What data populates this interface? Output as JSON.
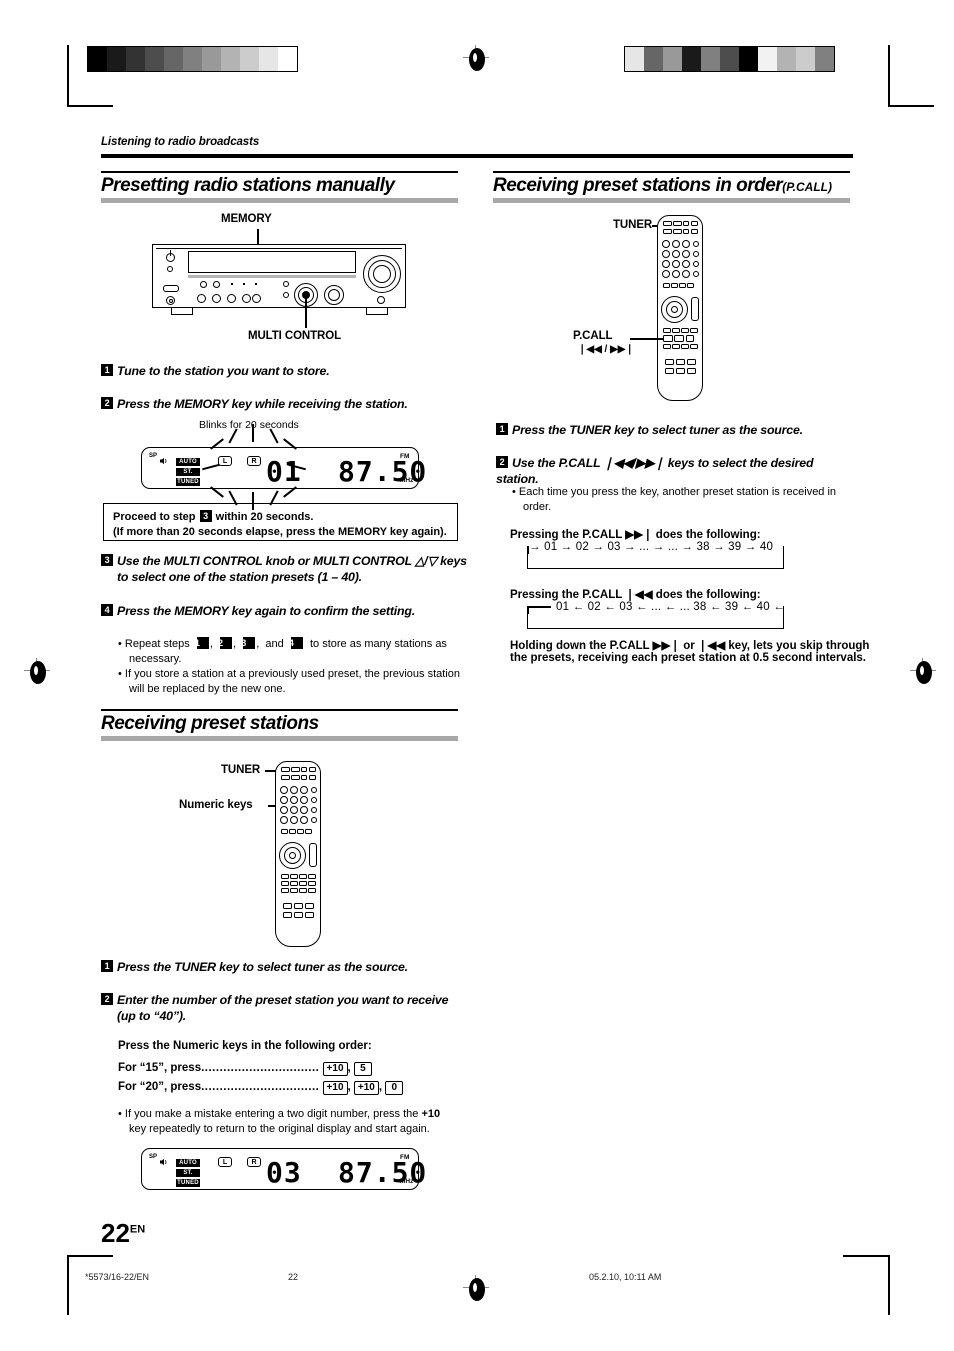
{
  "page": {
    "running_head": "Listening to radio broadcasts",
    "number": "22",
    "number_suffix": "EN"
  },
  "footer": {
    "left": "*5573/16-22/EN",
    "center": "22",
    "right": "05.2.10, 10:11 AM"
  },
  "sections": {
    "presetting": {
      "title": "Presetting radio stations manually",
      "diagram": {
        "memory_label": "MEMORY",
        "multi_control_label": "MULTI CONTROL"
      },
      "steps": [
        {
          "num": "1",
          "text": "Tune to the station you want to store."
        },
        {
          "num": "2",
          "text": "Press the MEMORY key while receiving the station."
        },
        {
          "num": "3",
          "line1": "Use the MULTI CONTROL knob or MULTI CONTROL △/▽ keys",
          "line2": "to select one of the station presets (1 – 40)."
        },
        {
          "num": "4",
          "text": "Press the MEMORY key  again to confirm the setting."
        }
      ],
      "blink_caption": "Blinks for 20 seconds",
      "display": {
        "sp_label": "SP",
        "auto": "AUTO",
        "st": "ST.",
        "tuned": "TUNED",
        "left": "L",
        "right": "R",
        "preset": "01",
        "frequency": "87.50",
        "band": "FM",
        "unit": "MHz"
      },
      "note_box": {
        "line1_a": "Proceed to step",
        "line1_num": "3",
        "line1_b": "within 20 seconds.",
        "line2": "(If more than 20 seconds elapse, press the MEMORY key again)."
      },
      "bullets": {
        "repeat_a": "Repeat steps",
        "repeat_nums": [
          "1",
          "2",
          "3",
          "4"
        ],
        "repeat_b": "to store as many stations as",
        "repeat_c": "necessary.",
        "replace_1": "If you store a station at a previously used preset, the previous station",
        "replace_2": "will be replaced by the new one."
      }
    },
    "receiving": {
      "title": "Receiving preset stations",
      "diagram": {
        "tuner_label": "TUNER",
        "numeric_label": "Numeric keys"
      },
      "steps": [
        {
          "num": "1",
          "text": "Press the TUNER key to select tuner as the source."
        },
        {
          "num": "2",
          "line1": "Enter the number of the preset station you want to receive",
          "line2": "(up to “40”)."
        }
      ],
      "order_heading": "Press the Numeric keys in the following order:",
      "examples": [
        {
          "label": "For “15”, press",
          "dots": "................................",
          "keys": [
            "+10",
            "5"
          ]
        },
        {
          "label": "For “20”, press",
          "dots": "................................",
          "keys": [
            "+10",
            "+10",
            "0"
          ]
        }
      ],
      "mistake_note_1a": "If you make a mistake entering a two digit number, press the",
      "mistake_note_1b": "+10",
      "mistake_note_2": "key repeatedly to return to the original display and start again.",
      "display": {
        "sp_label": "SP",
        "auto": "AUTO",
        "st": "ST.",
        "tuned": "TUNED",
        "left": "L",
        "right": "R",
        "preset": "03",
        "frequency": "87.50",
        "band": "FM",
        "unit": "MHz"
      }
    },
    "pcall": {
      "title": "Receiving preset stations in order",
      "title_sub": "(P.CALL)",
      "diagram": {
        "tuner_label": "TUNER",
        "pcall_label": "P.CALL",
        "pcall_keys": "❘◀◀ / ▶▶❘"
      },
      "steps": [
        {
          "num": "1",
          "text": "Press the TUNER key to select tuner as the source."
        },
        {
          "num": "2",
          "text": "Use the P.CALL ❘◀◀/▶▶❘ keys to select the desired station."
        }
      ],
      "bullet_1": "Each time you press the key, another preset station is received in",
      "bullet_2": "order.",
      "forward": {
        "heading_a": "Pressing the P.CALL",
        "heading_icon": "▶▶❘",
        "heading_b": "does the following:",
        "sequence": "→ 01 → 02 → 03 → ... → ... → 38 → 39 → 40"
      },
      "reverse": {
        "heading_a": "Pressing the P.CALL",
        "heading_icon": "❘◀◀",
        "heading_b": "does the following:",
        "sequence": "01 ← 02 ← 03 ← ... ← ... 38 ← 39 ← 40 ←"
      },
      "hold_note_1": "Holding down the P.CALL ▶▶❘ or ❘◀◀ key, lets you skip through",
      "hold_note_2": "the presets, receiving each preset station at 0.5 second intervals."
    }
  },
  "colors": {
    "heading_rule": "#a8a8a8",
    "ink": "#000000"
  }
}
